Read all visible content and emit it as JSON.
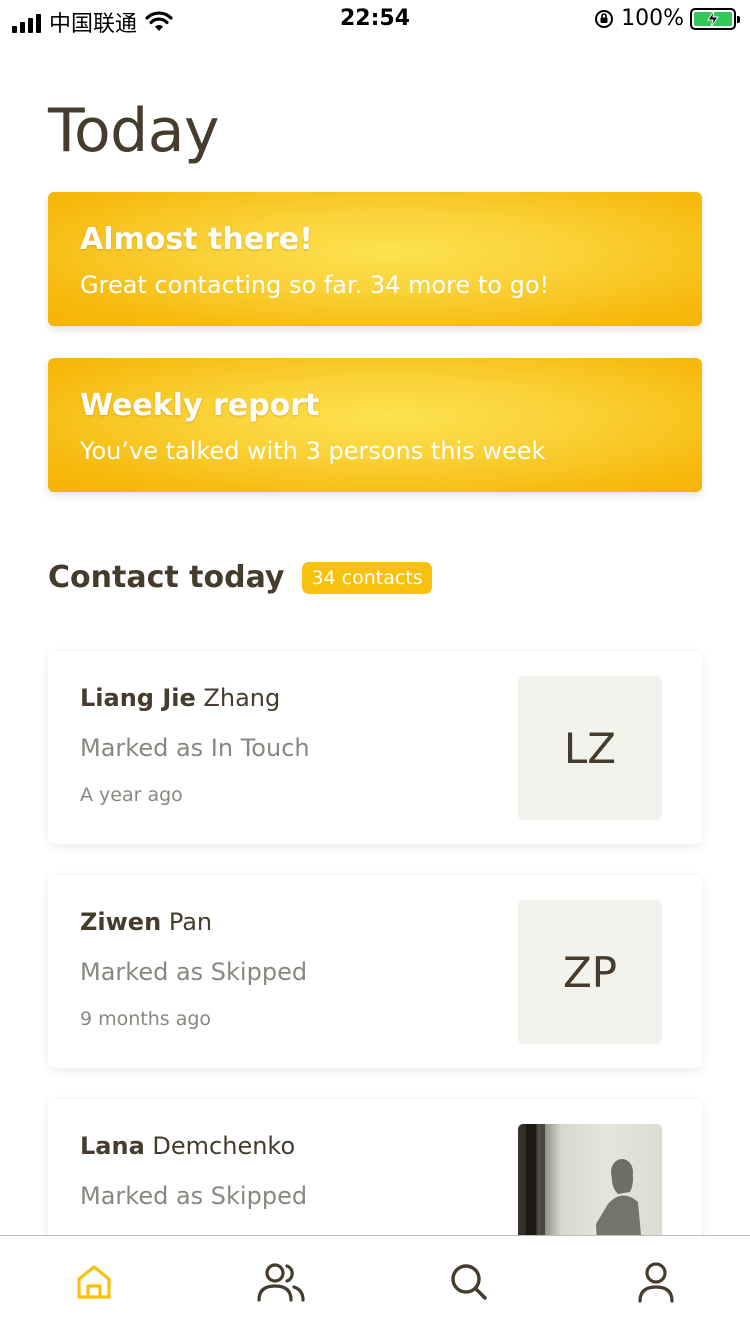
{
  "status_bar": {
    "carrier": "中国联通",
    "time": "22:54",
    "battery": "100%"
  },
  "page": {
    "title": "Today"
  },
  "banners": [
    {
      "title": "Almost there!",
      "text": "Great contacting so far. 34 more to go!"
    },
    {
      "title": "Weekly report",
      "text": "You’ve talked with 3 persons this week"
    }
  ],
  "section": {
    "title": "Contact today",
    "badge": "34 contacts"
  },
  "contacts": [
    {
      "first": "Liang Jie",
      "last": "Zhang",
      "status": "Marked as In Touch",
      "time": "A year ago",
      "initials": "LZ"
    },
    {
      "first": "Ziwen",
      "last": "Pan",
      "status": "Marked as Skipped",
      "time": "9 months ago",
      "initials": "ZP"
    },
    {
      "first": "Lana",
      "last": "Demchenko",
      "status": "Marked as Skipped",
      "time": "",
      "initials": ""
    }
  ],
  "colors": {
    "accent": "#f8c10d",
    "text": "#453c2d",
    "muted": "#8a8780"
  },
  "tabs": [
    {
      "icon": "home-icon",
      "active": true
    },
    {
      "icon": "people-icon",
      "active": false
    },
    {
      "icon": "search-icon",
      "active": false
    },
    {
      "icon": "profile-icon",
      "active": false
    }
  ]
}
